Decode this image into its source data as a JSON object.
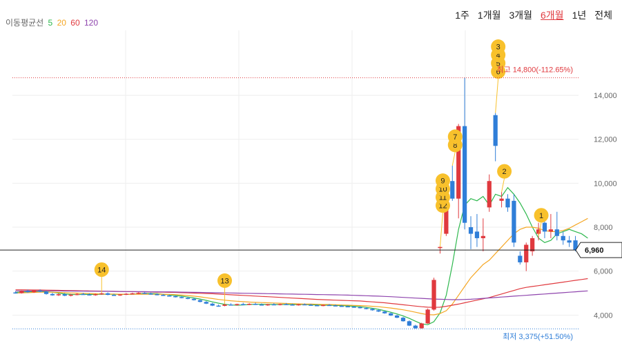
{
  "ma_legend": {
    "label": "이동평균선",
    "items": [
      {
        "text": "5",
        "color": "#2db84d"
      },
      {
        "text": "20",
        "color": "#f5a623"
      },
      {
        "text": "60",
        "color": "#e0393e"
      },
      {
        "text": "120",
        "color": "#8e44ad"
      }
    ]
  },
  "periods": [
    {
      "label": "1주",
      "active": false
    },
    {
      "label": "1개월",
      "active": false
    },
    {
      "label": "3개월",
      "active": false
    },
    {
      "label": "6개월",
      "active": true
    },
    {
      "label": "1년",
      "active": false
    },
    {
      "label": "전체",
      "active": false
    }
  ],
  "colors": {
    "up": "#e0393e",
    "down": "#2f7ed8",
    "marker": "#f8c12c",
    "grid": "#eeeeee"
  },
  "chart_data": {
    "type": "candlestick",
    "ylim": [
      3350,
      15700
    ],
    "yticks": [
      4000,
      6000,
      8000,
      10000,
      12000,
      14000
    ],
    "ytick_labels": [
      "4,000",
      "6,000",
      "8,000",
      "10,000",
      "12,000",
      "14,000"
    ],
    "current_price": {
      "value": 6960,
      "label": "6,960"
    },
    "high": {
      "value": 14800,
      "label": "최고 14,800(-112.65%)"
    },
    "low": {
      "value": 3375,
      "label": "최저 3,375(+51.50%)"
    },
    "candles": [
      [
        5030,
        5080,
        4980,
        5000
      ],
      [
        5000,
        5120,
        4980,
        5100
      ],
      [
        5100,
        5160,
        5020,
        5040
      ],
      [
        5040,
        5140,
        5010,
        5120
      ],
      [
        5120,
        5170,
        5040,
        5060
      ],
      [
        5060,
        5110,
        4930,
        4960
      ],
      [
        4960,
        5010,
        4880,
        4900
      ],
      [
        4900,
        4990,
        4870,
        4950
      ],
      [
        4950,
        5000,
        4860,
        4880
      ],
      [
        4880,
        4960,
        4850,
        4930
      ],
      [
        4930,
        4990,
        4900,
        4960
      ],
      [
        4960,
        5010,
        4920,
        4940
      ],
      [
        4940,
        4990,
        4890,
        4920
      ],
      [
        4920,
        4980,
        4880,
        4950
      ],
      [
        4950,
        5020,
        4920,
        4990
      ],
      [
        4990,
        5030,
        4900,
        4920
      ],
      [
        4920,
        4970,
        4880,
        4900
      ],
      [
        4900,
        4960,
        4870,
        4940
      ],
      [
        4940,
        5000,
        4910,
        4970
      ],
      [
        4970,
        5020,
        4940,
        4990
      ],
      [
        4990,
        5040,
        4950,
        5010
      ],
      [
        5010,
        5050,
        4960,
        4980
      ],
      [
        4980,
        5020,
        4930,
        4950
      ],
      [
        4950,
        4990,
        4900,
        4920
      ],
      [
        4920,
        4960,
        4870,
        4890
      ],
      [
        4890,
        4930,
        4840,
        4860
      ],
      [
        4860,
        4900,
        4800,
        4820
      ],
      [
        4820,
        4860,
        4760,
        4780
      ],
      [
        4780,
        4820,
        4720,
        4740
      ],
      [
        4740,
        4780,
        4660,
        4680
      ],
      [
        4680,
        4720,
        4580,
        4600
      ],
      [
        4600,
        4640,
        4500,
        4520
      ],
      [
        4520,
        4560,
        4410,
        4430
      ],
      [
        4430,
        4480,
        4380,
        4420
      ],
      [
        4420,
        4500,
        4400,
        4480
      ],
      [
        4480,
        4540,
        4440,
        4460
      ],
      [
        4460,
        4520,
        4430,
        4500
      ],
      [
        4500,
        4560,
        4460,
        4480
      ],
      [
        4480,
        4540,
        4450,
        4510
      ],
      [
        4510,
        4560,
        4460,
        4480
      ],
      [
        4480,
        4530,
        4440,
        4460
      ],
      [
        4460,
        4510,
        4420,
        4490
      ],
      [
        4490,
        4540,
        4450,
        4470
      ],
      [
        4470,
        4520,
        4440,
        4500
      ],
      [
        4500,
        4550,
        4460,
        4480
      ],
      [
        4480,
        4520,
        4440,
        4460
      ],
      [
        4460,
        4510,
        4430,
        4490
      ],
      [
        4490,
        4530,
        4450,
        4470
      ],
      [
        4470,
        4510,
        4430,
        4450
      ],
      [
        4450,
        4490,
        4410,
        4430
      ],
      [
        4430,
        4480,
        4400,
        4460
      ],
      [
        4460,
        4500,
        4420,
        4440
      ],
      [
        4440,
        4480,
        4400,
        4420
      ],
      [
        4420,
        4460,
        4380,
        4400
      ],
      [
        4400,
        4440,
        4360,
        4380
      ],
      [
        4380,
        4420,
        4340,
        4360
      ],
      [
        4360,
        4400,
        4300,
        4320
      ],
      [
        4320,
        4360,
        4260,
        4280
      ],
      [
        4280,
        4320,
        4200,
        4220
      ],
      [
        4220,
        4260,
        4140,
        4160
      ],
      [
        4160,
        4200,
        4060,
        4080
      ],
      [
        4080,
        4120,
        3960,
        3980
      ],
      [
        3980,
        4020,
        3860,
        3880
      ],
      [
        3880,
        3920,
        3700,
        3720
      ],
      [
        3720,
        3760,
        3500,
        3520
      ],
      [
        3520,
        3560,
        3375,
        3400
      ],
      [
        3400,
        3650,
        3380,
        3620
      ],
      [
        3620,
        4300,
        3600,
        4250
      ],
      [
        4250,
        5700,
        4200,
        5600
      ],
      [
        7050,
        7150,
        6800,
        7100
      ],
      [
        7700,
        9800,
        7600,
        9600
      ],
      [
        10100,
        10800,
        9200,
        9300
      ],
      [
        9300,
        12700,
        8400,
        12600
      ],
      [
        12600,
        14800,
        7900,
        8200
      ],
      [
        8000,
        8500,
        7000,
        7700
      ],
      [
        7800,
        8600,
        7100,
        7500
      ],
      [
        7500,
        8400,
        6900,
        7600
      ],
      [
        8900,
        10400,
        8700,
        10100
      ],
      [
        13100,
        13200,
        11000,
        11700
      ],
      [
        9200,
        9600,
        8900,
        9300
      ],
      [
        9300,
        9500,
        8700,
        8900
      ],
      [
        9200,
        9500,
        7100,
        7300
      ],
      [
        6700,
        6900,
        6300,
        6400
      ],
      [
        6400,
        7300,
        6000,
        7200
      ],
      [
        6900,
        7600,
        6700,
        7500
      ],
      [
        7700,
        8200,
        7400,
        7900
      ],
      [
        8200,
        8400,
        7500,
        7800
      ],
      [
        7800,
        8600,
        7500,
        7900
      ],
      [
        7900,
        8700,
        7400,
        7600
      ],
      [
        7600,
        7800,
        7200,
        7400
      ],
      [
        7400,
        7600,
        7100,
        7300
      ],
      [
        7400,
        7600,
        6900,
        6960
      ]
    ],
    "series": [
      {
        "color": "#2db84d",
        "values": [
          5030,
          5050,
          5060,
          5070,
          5080,
          5060,
          5040,
          5000,
          4960,
          4940,
          4930,
          4940,
          4940,
          4940,
          4950,
          4950,
          4950,
          4940,
          4940,
          4950,
          4970,
          4980,
          4980,
          4970,
          4950,
          4920,
          4890,
          4860,
          4820,
          4780,
          4730,
          4670,
          4600,
          4540,
          4490,
          4460,
          4450,
          4460,
          4480,
          4490,
          4490,
          4480,
          4480,
          4480,
          4480,
          4480,
          4480,
          4480,
          4470,
          4460,
          4450,
          4450,
          4440,
          4430,
          4420,
          4400,
          4380,
          4350,
          4310,
          4260,
          4200,
          4130,
          4050,
          3960,
          3850,
          3720,
          3600,
          3560,
          3700,
          4100,
          4900,
          6300,
          7900,
          9000,
          9300,
          9200,
          9400,
          9000,
          9500,
          9400,
          9800,
          9500,
          9100,
          8600,
          8000,
          7500,
          7300,
          7400,
          7700,
          7800,
          7900,
          7800,
          7700,
          7500
        ]
      },
      {
        "color": "#f5a623",
        "values": [
          5000,
          5010,
          5020,
          5030,
          5040,
          5040,
          5040,
          5030,
          5020,
          5010,
          5000,
          4990,
          4980,
          4970,
          4960,
          4960,
          4960,
          4950,
          4950,
          4950,
          4950,
          4950,
          4950,
          4950,
          4950,
          4940,
          4930,
          4910,
          4890,
          4860,
          4830,
          4790,
          4750,
          4710,
          4680,
          4650,
          4630,
          4610,
          4590,
          4580,
          4570,
          4560,
          4550,
          4540,
          4530,
          4520,
          4510,
          4500,
          4500,
          4490,
          4480,
          4480,
          4470,
          4460,
          4450,
          4440,
          4430,
          4420,
          4400,
          4380,
          4350,
          4320,
          4280,
          4240,
          4190,
          4130,
          4070,
          4020,
          4010,
          4070,
          4200,
          4500,
          4900,
          5300,
          5700,
          6000,
          6300,
          6500,
          6800,
          7100,
          7400,
          7700,
          7900,
          8000,
          8000,
          7950,
          7850,
          7800,
          7800,
          7850,
          7950,
          8100,
          8250,
          8400
        ]
      },
      {
        "color": "#e0393e",
        "values": [
          5150,
          5150,
          5145,
          5140,
          5140,
          5135,
          5130,
          5125,
          5120,
          5115,
          5110,
          5105,
          5100,
          5095,
          5090,
          5085,
          5080,
          5075,
          5070,
          5065,
          5060,
          5055,
          5050,
          5045,
          5040,
          5035,
          5030,
          5020,
          5010,
          5000,
          4990,
          4980,
          4970,
          4955,
          4940,
          4925,
          4910,
          4895,
          4880,
          4865,
          4850,
          4835,
          4820,
          4805,
          4790,
          4775,
          4760,
          4745,
          4730,
          4715,
          4700,
          4690,
          4680,
          4670,
          4660,
          4650,
          4640,
          4620,
          4600,
          4580,
          4560,
          4530,
          4500,
          4470,
          4440,
          4410,
          4380,
          4360,
          4350,
          4360,
          4400,
          4450,
          4500,
          4560,
          4620,
          4680,
          4740,
          4800,
          4880,
          4960,
          5040,
          5120,
          5200,
          5260,
          5300,
          5340,
          5380,
          5420,
          5460,
          5500,
          5540,
          5580,
          5620,
          5660
        ]
      },
      {
        "color": "#8e44ad",
        "values": [
          5100,
          5100,
          5100,
          5100,
          5100,
          5100,
          5100,
          5100,
          5095,
          5095,
          5090,
          5090,
          5085,
          5085,
          5080,
          5080,
          5075,
          5075,
          5070,
          5070,
          5065,
          5065,
          5060,
          5060,
          5055,
          5055,
          5050,
          5045,
          5040,
          5035,
          5030,
          5025,
          5020,
          5015,
          5010,
          5005,
          5000,
          4995,
          4990,
          4985,
          4980,
          4975,
          4970,
          4965,
          4960,
          4955,
          4950,
          4945,
          4940,
          4935,
          4930,
          4925,
          4920,
          4915,
          4910,
          4900,
          4890,
          4880,
          4870,
          4860,
          4850,
          4835,
          4820,
          4805,
          4790,
          4775,
          4760,
          4745,
          4730,
          4720,
          4710,
          4700,
          4700,
          4710,
          4720,
          4740,
          4760,
          4780,
          4800,
          4820,
          4840,
          4860,
          4880,
          4900,
          4920,
          4940,
          4960,
          4980,
          5000,
          5020,
          5040,
          5060,
          5080,
          5100
        ]
      }
    ],
    "markers": [
      {
        "label": "14",
        "index": 14,
        "value": 5000
      },
      {
        "label": "13",
        "index": 34,
        "value": 4500
      },
      {
        "label": "12",
        "index": 69,
        "value": 7100
      },
      {
        "label": "11",
        "index": 69,
        "value": 7100
      },
      {
        "label": "10",
        "index": 69,
        "value": 7100
      },
      {
        "label": "9",
        "index": 69,
        "value": 7100
      },
      {
        "label": "8",
        "index": 71,
        "value": 10800
      },
      {
        "label": "7",
        "index": 71,
        "value": 10800
      },
      {
        "label": "6",
        "index": 78,
        "value": 13200
      },
      {
        "label": "5",
        "index": 78,
        "value": 13200
      },
      {
        "label": "4",
        "index": 78,
        "value": 13200
      },
      {
        "label": "3",
        "index": 78,
        "value": 13200
      },
      {
        "label": "2",
        "index": 79,
        "value": 9600
      },
      {
        "label": "1",
        "index": 85,
        "value": 7600
      }
    ]
  }
}
